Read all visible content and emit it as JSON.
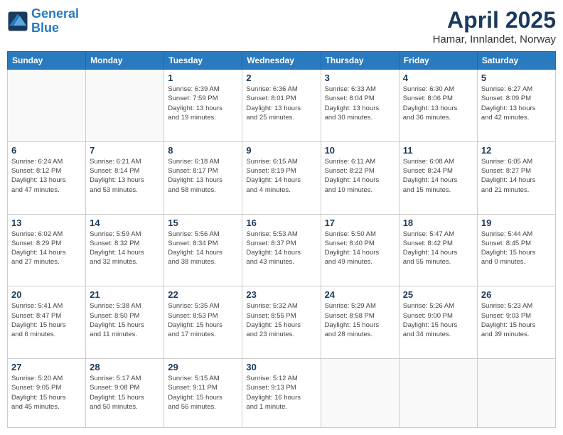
{
  "header": {
    "logo_line1": "General",
    "logo_line2": "Blue",
    "title": "April 2025",
    "subtitle": "Hamar, Innlandet, Norway"
  },
  "weekdays": [
    "Sunday",
    "Monday",
    "Tuesday",
    "Wednesday",
    "Thursday",
    "Friday",
    "Saturday"
  ],
  "weeks": [
    [
      {
        "day": "",
        "info": ""
      },
      {
        "day": "",
        "info": ""
      },
      {
        "day": "1",
        "info": "Sunrise: 6:39 AM\nSunset: 7:59 PM\nDaylight: 13 hours\nand 19 minutes."
      },
      {
        "day": "2",
        "info": "Sunrise: 6:36 AM\nSunset: 8:01 PM\nDaylight: 13 hours\nand 25 minutes."
      },
      {
        "day": "3",
        "info": "Sunrise: 6:33 AM\nSunset: 8:04 PM\nDaylight: 13 hours\nand 30 minutes."
      },
      {
        "day": "4",
        "info": "Sunrise: 6:30 AM\nSunset: 8:06 PM\nDaylight: 13 hours\nand 36 minutes."
      },
      {
        "day": "5",
        "info": "Sunrise: 6:27 AM\nSunset: 8:09 PM\nDaylight: 13 hours\nand 42 minutes."
      }
    ],
    [
      {
        "day": "6",
        "info": "Sunrise: 6:24 AM\nSunset: 8:12 PM\nDaylight: 13 hours\nand 47 minutes."
      },
      {
        "day": "7",
        "info": "Sunrise: 6:21 AM\nSunset: 8:14 PM\nDaylight: 13 hours\nand 53 minutes."
      },
      {
        "day": "8",
        "info": "Sunrise: 6:18 AM\nSunset: 8:17 PM\nDaylight: 13 hours\nand 58 minutes."
      },
      {
        "day": "9",
        "info": "Sunrise: 6:15 AM\nSunset: 8:19 PM\nDaylight: 14 hours\nand 4 minutes."
      },
      {
        "day": "10",
        "info": "Sunrise: 6:11 AM\nSunset: 8:22 PM\nDaylight: 14 hours\nand 10 minutes."
      },
      {
        "day": "11",
        "info": "Sunrise: 6:08 AM\nSunset: 8:24 PM\nDaylight: 14 hours\nand 15 minutes."
      },
      {
        "day": "12",
        "info": "Sunrise: 6:05 AM\nSunset: 8:27 PM\nDaylight: 14 hours\nand 21 minutes."
      }
    ],
    [
      {
        "day": "13",
        "info": "Sunrise: 6:02 AM\nSunset: 8:29 PM\nDaylight: 14 hours\nand 27 minutes."
      },
      {
        "day": "14",
        "info": "Sunrise: 5:59 AM\nSunset: 8:32 PM\nDaylight: 14 hours\nand 32 minutes."
      },
      {
        "day": "15",
        "info": "Sunrise: 5:56 AM\nSunset: 8:34 PM\nDaylight: 14 hours\nand 38 minutes."
      },
      {
        "day": "16",
        "info": "Sunrise: 5:53 AM\nSunset: 8:37 PM\nDaylight: 14 hours\nand 43 minutes."
      },
      {
        "day": "17",
        "info": "Sunrise: 5:50 AM\nSunset: 8:40 PM\nDaylight: 14 hours\nand 49 minutes."
      },
      {
        "day": "18",
        "info": "Sunrise: 5:47 AM\nSunset: 8:42 PM\nDaylight: 14 hours\nand 55 minutes."
      },
      {
        "day": "19",
        "info": "Sunrise: 5:44 AM\nSunset: 8:45 PM\nDaylight: 15 hours\nand 0 minutes."
      }
    ],
    [
      {
        "day": "20",
        "info": "Sunrise: 5:41 AM\nSunset: 8:47 PM\nDaylight: 15 hours\nand 6 minutes."
      },
      {
        "day": "21",
        "info": "Sunrise: 5:38 AM\nSunset: 8:50 PM\nDaylight: 15 hours\nand 11 minutes."
      },
      {
        "day": "22",
        "info": "Sunrise: 5:35 AM\nSunset: 8:53 PM\nDaylight: 15 hours\nand 17 minutes."
      },
      {
        "day": "23",
        "info": "Sunrise: 5:32 AM\nSunset: 8:55 PM\nDaylight: 15 hours\nand 23 minutes."
      },
      {
        "day": "24",
        "info": "Sunrise: 5:29 AM\nSunset: 8:58 PM\nDaylight: 15 hours\nand 28 minutes."
      },
      {
        "day": "25",
        "info": "Sunrise: 5:26 AM\nSunset: 9:00 PM\nDaylight: 15 hours\nand 34 minutes."
      },
      {
        "day": "26",
        "info": "Sunrise: 5:23 AM\nSunset: 9:03 PM\nDaylight: 15 hours\nand 39 minutes."
      }
    ],
    [
      {
        "day": "27",
        "info": "Sunrise: 5:20 AM\nSunset: 9:05 PM\nDaylight: 15 hours\nand 45 minutes."
      },
      {
        "day": "28",
        "info": "Sunrise: 5:17 AM\nSunset: 9:08 PM\nDaylight: 15 hours\nand 50 minutes."
      },
      {
        "day": "29",
        "info": "Sunrise: 5:15 AM\nSunset: 9:11 PM\nDaylight: 15 hours\nand 56 minutes."
      },
      {
        "day": "30",
        "info": "Sunrise: 5:12 AM\nSunset: 9:13 PM\nDaylight: 16 hours\nand 1 minute."
      },
      {
        "day": "",
        "info": ""
      },
      {
        "day": "",
        "info": ""
      },
      {
        "day": "",
        "info": ""
      }
    ]
  ]
}
